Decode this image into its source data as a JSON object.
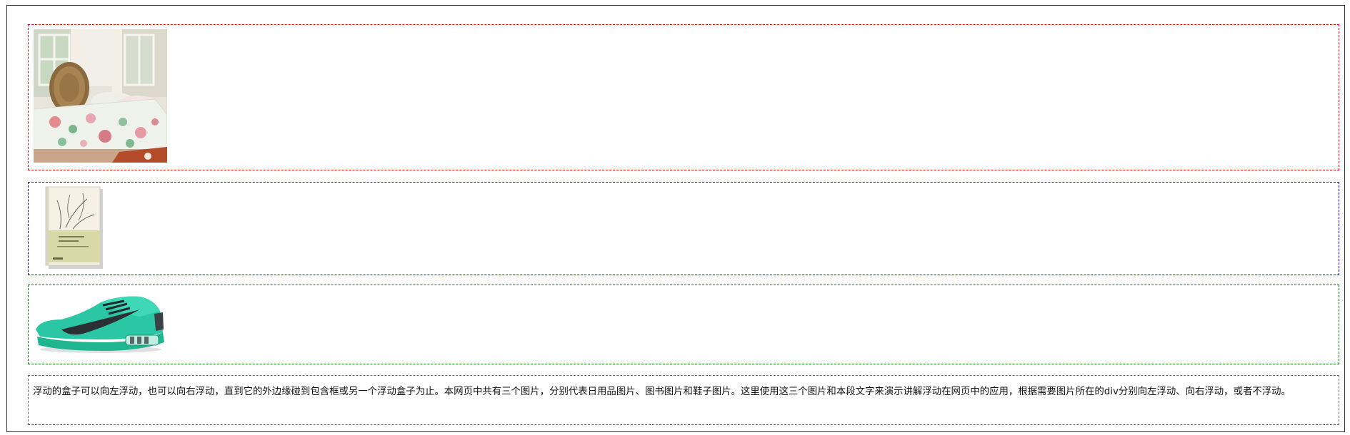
{
  "boxes": [
    {
      "name": "bedding-box",
      "border_color": "#ff0000",
      "image": "bedding-photo"
    },
    {
      "name": "book-box",
      "border_color": "#0000ff",
      "image": "book-photo"
    },
    {
      "name": "shoe-box",
      "border_color": "#008000",
      "image": "shoe-photo"
    }
  ],
  "paragraph": {
    "text": "浮动的盒子可以向左浮动，也可以向右浮动，直到它的外边缘碰到包含框或另一个浮动盒子为止。本网页中共有三个图片，分别代表日用品图片、图书图片和鞋子图片。这里使用这三个图片和本段文字来演示讲解浮动在网页中的应用，根据需要图片所在的div分别向左浮动、向右浮动，或者不浮动。",
    "border_color": "#666666"
  }
}
